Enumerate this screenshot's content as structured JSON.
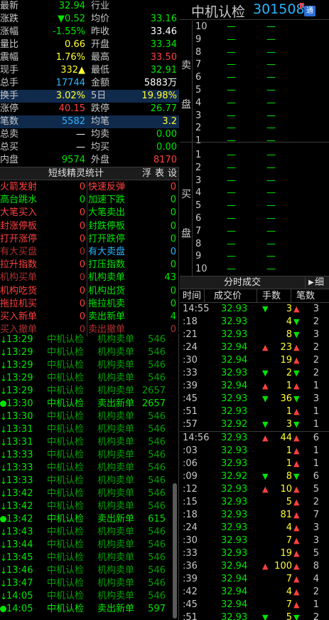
{
  "stats": [
    {
      "l1": "最新",
      "v1": "32.94",
      "c1": "down",
      "l2": "行业",
      "v2": "",
      "c2": "gray",
      "blue": false
    },
    {
      "l1": "涨跌",
      "v1": "▼0.52",
      "c1": "down",
      "l2": "均价",
      "v2": "33.16",
      "c2": "down",
      "blue": false
    },
    {
      "l1": "涨幅",
      "v1": "-1.55%",
      "c1": "down",
      "l2": "昨收",
      "v2": "33.46",
      "c2": "white",
      "blue": false
    },
    {
      "l1": "量比",
      "v1": "0.66",
      "c1": "yellow",
      "l2": "开盘",
      "v2": "33.34",
      "c2": "down",
      "blue": false
    },
    {
      "l1": "震幅",
      "v1": "1.76%",
      "c1": "yellow",
      "l2": "最高",
      "v2": "33.50",
      "c2": "up",
      "blue": false
    },
    {
      "l1": "现手",
      "v1": "332▲",
      "c1": "yellow",
      "l2": "最低",
      "v2": "32.91",
      "c2": "down",
      "blue": false
    },
    {
      "l1": "总手",
      "v1": "17744",
      "c1": "cyan",
      "l2": "金额",
      "v2": "5883万",
      "c2": "white",
      "blue": false
    },
    {
      "l1": "换手",
      "v1": "3.02%",
      "c1": "yellow",
      "l2": "5日",
      "v2": "19.98%",
      "c2": "yellow",
      "blue": true
    },
    {
      "l1": "涨停",
      "v1": "40.15",
      "c1": "up",
      "l2": "跌停",
      "v2": "26.77",
      "c2": "down",
      "blue": false
    },
    {
      "l1": "笔数",
      "v1": "5582",
      "c1": "cyan",
      "l2": "均笔",
      "v2": "3.2",
      "c2": "yellow",
      "blue": true
    },
    {
      "l1": "总卖",
      "v1": "—",
      "c1": "white",
      "l2": "均卖",
      "v2": "0.00",
      "c2": "down",
      "blue": false
    },
    {
      "l1": "总买",
      "v1": "—",
      "c1": "white",
      "l2": "均买",
      "v2": "0.00",
      "c2": "down",
      "blue": false
    },
    {
      "l1": "内盘",
      "v1": "9574",
      "c1": "down",
      "l2": "外盘",
      "v2": "8170",
      "c2": "up",
      "blue": false
    }
  ],
  "elf": {
    "title": "短线精灵统计",
    "buttons": [
      "浮",
      "表",
      "设"
    ],
    "rows": [
      {
        "n1": "火箭发射",
        "c1": "0",
        "k1": "c-red",
        "n2": "快速反弹",
        "c2": "0",
        "k2": "c-red"
      },
      {
        "n1": "高台跳水",
        "c1": "0",
        "k1": "c-green",
        "n2": "加速下跌",
        "c2": "0",
        "k2": "c-green"
      },
      {
        "n1": "大笔买入",
        "c1": "0",
        "k1": "c-red",
        "n2": "大笔卖出",
        "c2": "0",
        "k2": "c-green"
      },
      {
        "n1": "封涨停板",
        "c1": "0",
        "k1": "c-red",
        "n2": "封跌停板",
        "c2": "0",
        "k2": "c-green"
      },
      {
        "n1": "打开涨停",
        "c1": "0",
        "k1": "c-red",
        "n2": "打开跌停",
        "c2": "0",
        "k2": "c-green"
      },
      {
        "n1": "有大买盘",
        "c1": "0",
        "k1": "c-dred",
        "n2": "有大卖盘",
        "c2": "0",
        "k2": "c-cyan"
      },
      {
        "n1": "拉升指数",
        "c1": "0",
        "k1": "c-red",
        "n2": "打压指数",
        "c2": "0",
        "k2": "c-green"
      },
      {
        "n1": "机构买单",
        "c1": "0",
        "k1": "c-dred",
        "n2": "机构卖单",
        "c2": "43",
        "k2": "c-green"
      },
      {
        "n1": "机构吃货",
        "c1": "0",
        "k1": "c-red",
        "n2": "机构出货",
        "c2": "0",
        "k2": "c-green"
      },
      {
        "n1": "拖拉机买",
        "c1": "0",
        "k1": "c-red",
        "n2": "拖拉机卖",
        "c2": "0",
        "k2": "c-green"
      },
      {
        "n1": "买入新单",
        "c1": "0",
        "k1": "c-red",
        "n2": "卖出新单",
        "c2": "4",
        "k2": "c-green"
      },
      {
        "n1": "买入撤单",
        "c1": "0",
        "k1": "c-dred",
        "n2": "卖出撤单",
        "c2": "0",
        "k2": "c-dred"
      }
    ]
  },
  "events": [
    {
      "icon": "↓",
      "time": "13:29",
      "stock": "中机认检",
      "type": "机构卖单",
      "vol": "546",
      "bold": false
    },
    {
      "icon": "↓",
      "time": "13:29",
      "stock": "中机认检",
      "type": "机构卖单",
      "vol": "546",
      "bold": false
    },
    {
      "icon": "↓",
      "time": "13:29",
      "stock": "中机认检",
      "type": "机构卖单",
      "vol": "546",
      "bold": false
    },
    {
      "icon": "↓",
      "time": "13:29",
      "stock": "中机认检",
      "type": "机构卖单",
      "vol": "546",
      "bold": false
    },
    {
      "icon": "↓",
      "time": "13:29",
      "stock": "中机认检",
      "type": "机构卖单",
      "vol": "2657",
      "bold": false
    },
    {
      "icon": "●",
      "time": "13:30",
      "stock": "中机认检",
      "type": "卖出新单",
      "vol": "2657",
      "bold": true
    },
    {
      "icon": "↓",
      "time": "13:30",
      "stock": "中机认检",
      "type": "机构卖单",
      "vol": "546",
      "bold": false
    },
    {
      "icon": "↓",
      "time": "13:31",
      "stock": "中机认检",
      "type": "机构卖单",
      "vol": "546",
      "bold": false
    },
    {
      "icon": "↓",
      "time": "13:31",
      "stock": "中机认检",
      "type": "机构卖单",
      "vol": "546",
      "bold": false
    },
    {
      "icon": "↓",
      "time": "13:33",
      "stock": "中机认检",
      "type": "机构卖单",
      "vol": "546",
      "bold": false
    },
    {
      "icon": "↓",
      "time": "13:33",
      "stock": "中机认检",
      "type": "机构卖单",
      "vol": "546",
      "bold": false
    },
    {
      "icon": "↓",
      "time": "13:33",
      "stock": "中机认检",
      "type": "机构卖单",
      "vol": "546",
      "bold": false
    },
    {
      "icon": "↓",
      "time": "13:42",
      "stock": "中机认检",
      "type": "机构卖单",
      "vol": "546",
      "bold": false
    },
    {
      "icon": "↓",
      "time": "13:42",
      "stock": "中机认检",
      "type": "机构卖单",
      "vol": "546",
      "bold": false
    },
    {
      "icon": "●",
      "time": "13:42",
      "stock": "中机认检",
      "type": "卖出新单",
      "vol": "615",
      "bold": true
    },
    {
      "icon": "↓",
      "time": "13:43",
      "stock": "中机认检",
      "type": "机构卖单",
      "vol": "546",
      "bold": false
    },
    {
      "icon": "↓",
      "time": "13:44",
      "stock": "中机认检",
      "type": "机构卖单",
      "vol": "546",
      "bold": false
    },
    {
      "icon": "↓",
      "time": "13:45",
      "stock": "中机认检",
      "type": "机构卖单",
      "vol": "546",
      "bold": false
    },
    {
      "icon": "↓",
      "time": "13:46",
      "stock": "中机认检",
      "type": "机构卖单",
      "vol": "546",
      "bold": false
    },
    {
      "icon": "↓",
      "time": "13:47",
      "stock": "中机认检",
      "type": "机构卖单",
      "vol": "546",
      "bold": false
    },
    {
      "icon": "↓",
      "time": "14:05",
      "stock": "中机认检",
      "type": "机构卖单",
      "vol": "546",
      "bold": false
    },
    {
      "icon": "●",
      "time": "14:05",
      "stock": "中机认检",
      "type": "卖出新单",
      "vol": "597",
      "bold": true
    }
  ],
  "header": {
    "name": "中机认检",
    "code": "301508",
    "r_mark": "R",
    "tong": "通"
  },
  "book": {
    "sell_label": [
      "卖",
      "盘"
    ],
    "buy_label": [
      "买",
      "盘"
    ],
    "sell": [
      {
        "n": "10",
        "p": "—",
        "v": "—"
      },
      {
        "n": "9",
        "p": "—",
        "v": "—"
      },
      {
        "n": "8",
        "p": "—",
        "v": "—"
      },
      {
        "n": "7",
        "p": "—",
        "v": "—"
      },
      {
        "n": "6",
        "p": "—",
        "v": "—"
      },
      {
        "n": "5",
        "p": "—",
        "v": "—"
      },
      {
        "n": "4",
        "p": "—",
        "v": "—"
      },
      {
        "n": "3",
        "p": "—",
        "v": "—"
      },
      {
        "n": "2",
        "p": "—",
        "v": "—"
      },
      {
        "n": "1",
        "p": "—",
        "v": "—"
      }
    ],
    "buy": [
      {
        "n": "1",
        "p": "—",
        "v": "—"
      },
      {
        "n": "2",
        "p": "—",
        "v": "—"
      },
      {
        "n": "3",
        "p": "—",
        "v": "—"
      },
      {
        "n": "4",
        "p": "—",
        "v": "—"
      },
      {
        "n": "5",
        "p": "—",
        "v": "—"
      },
      {
        "n": "6",
        "p": "—",
        "v": "—"
      },
      {
        "n": "7",
        "p": "—",
        "v": "—"
      },
      {
        "n": "8",
        "p": "—",
        "v": "—"
      },
      {
        "n": "9",
        "p": "—",
        "v": "—"
      },
      {
        "n": "10",
        "p": "—",
        "v": "—"
      }
    ]
  },
  "trades": {
    "title": "分时成交",
    "arrow": "▶",
    "detail": "细",
    "columns": [
      "时间",
      "成交价",
      "手数",
      "笔数"
    ],
    "groups": [
      [
        {
          "time": "14:55",
          "price": "32.93",
          "pa": "▼",
          "pc": "down",
          "vol": "3",
          "va": "▲",
          "vc": "yellow",
          "cnt": "3"
        },
        {
          "time": ":18",
          "price": "32.93",
          "pa": "",
          "pc": "down",
          "vol": "4",
          "va": "▼",
          "vc": "yellow",
          "cnt": "2"
        },
        {
          "time": ":21",
          "price": "32.93",
          "pa": "",
          "pc": "down",
          "vol": "8",
          "va": "▼",
          "vc": "yellow",
          "cnt": "3"
        },
        {
          "time": ":24",
          "price": "32.94",
          "pa": "▲",
          "pc": "down",
          "vol": "23",
          "va": "▲",
          "vc": "yellow",
          "cnt": "2"
        },
        {
          "time": ":30",
          "price": "32.94",
          "pa": "",
          "pc": "down",
          "vol": "19",
          "va": "▲",
          "vc": "yellow",
          "cnt": "2"
        },
        {
          "time": ":33",
          "price": "32.93",
          "pa": "▼",
          "pc": "down",
          "vol": "2",
          "va": "▼",
          "vc": "yellow",
          "cnt": "2"
        },
        {
          "time": ":39",
          "price": "32.94",
          "pa": "▲",
          "pc": "down",
          "vol": "1",
          "va": "▲",
          "vc": "yellow",
          "cnt": "1"
        },
        {
          "time": ":45",
          "price": "32.93",
          "pa": "▼",
          "pc": "down",
          "vol": "36",
          "va": "▼",
          "vc": "yellow",
          "cnt": "3"
        },
        {
          "time": ":51",
          "price": "32.93",
          "pa": "",
          "pc": "down",
          "vol": "1",
          "va": "▲",
          "vc": "yellow",
          "cnt": "1"
        },
        {
          "time": ":57",
          "price": "32.92",
          "pa": "▼",
          "pc": "down",
          "vol": "3",
          "va": "▼",
          "vc": "yellow",
          "cnt": "1"
        }
      ],
      [
        {
          "time": "14:56",
          "price": "32.93",
          "pa": "▲",
          "pc": "down",
          "vol": "44",
          "va": "▲",
          "vc": "yellow",
          "cnt": "6"
        },
        {
          "time": ":03",
          "price": "32.93",
          "pa": "",
          "pc": "down",
          "vol": "1",
          "va": "▲",
          "vc": "yellow",
          "cnt": "1"
        },
        {
          "time": ":06",
          "price": "32.93",
          "pa": "",
          "pc": "down",
          "vol": "1",
          "va": "▲",
          "vc": "yellow",
          "cnt": "1"
        },
        {
          "time": ":09",
          "price": "32.92",
          "pa": "▼",
          "pc": "down",
          "vol": "8",
          "va": "▼",
          "vc": "yellow",
          "cnt": "6"
        },
        {
          "time": ":12",
          "price": "32.93",
          "pa": "▲",
          "pc": "down",
          "vol": "10",
          "va": "▲",
          "vc": "yellow",
          "cnt": "5"
        },
        {
          "time": ":15",
          "price": "32.93",
          "pa": "",
          "pc": "down",
          "vol": "5",
          "va": "▲",
          "vc": "yellow",
          "cnt": "2"
        },
        {
          "time": ":18",
          "price": "32.93",
          "pa": "",
          "pc": "down",
          "vol": "81",
          "va": "▲",
          "vc": "yellow",
          "cnt": "7"
        },
        {
          "time": ":24",
          "price": "32.93",
          "pa": "",
          "pc": "down",
          "vol": "4",
          "va": "▲",
          "vc": "yellow",
          "cnt": "3"
        },
        {
          "time": ":30",
          "price": "32.93",
          "pa": "",
          "pc": "down",
          "vol": "7",
          "va": "▲",
          "vc": "yellow",
          "cnt": "3"
        },
        {
          "time": ":33",
          "price": "32.93",
          "pa": "",
          "pc": "down",
          "vol": "19",
          "va": "▲",
          "vc": "yellow",
          "cnt": "5"
        },
        {
          "time": ":36",
          "price": "32.94",
          "pa": "▲",
          "pc": "down",
          "vol": "100",
          "va": "▲",
          "vc": "yellow",
          "cnt": "8"
        },
        {
          "time": ":39",
          "price": "32.94",
          "pa": "",
          "pc": "down",
          "vol": "7",
          "va": "▲",
          "vc": "yellow",
          "cnt": "4"
        },
        {
          "time": ":42",
          "price": "32.94",
          "pa": "",
          "pc": "down",
          "vol": "4",
          "va": "▲",
          "vc": "yellow",
          "cnt": "2"
        },
        {
          "time": ":45",
          "price": "32.94",
          "pa": "",
          "pc": "down",
          "vol": "7",
          "va": "▲",
          "vc": "yellow",
          "cnt": "1"
        },
        {
          "time": ":51",
          "price": "32.93",
          "pa": "▼",
          "pc": "down",
          "vol": "5",
          "va": "▼",
          "vc": "yellow",
          "cnt": "2"
        }
      ]
    ]
  },
  "colors": {
    "up": "#ff4040",
    "down": "#00e600",
    "yellow": "#ffff30",
    "cyan": "#29b6ff",
    "bg": "#000000",
    "grid": "#3a3a3a"
  }
}
